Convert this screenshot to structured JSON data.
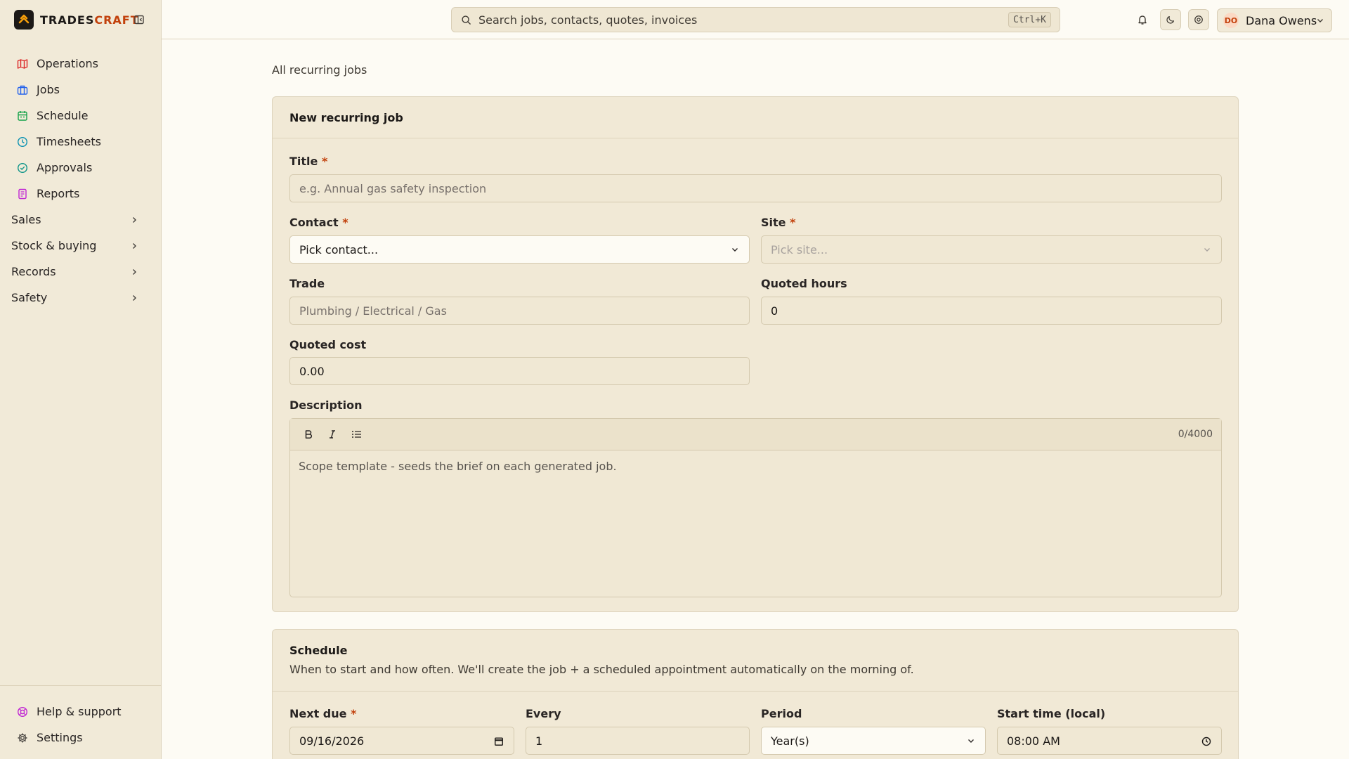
{
  "brand": {
    "name_main": "TRADES",
    "name_accent": "CRAFT"
  },
  "sidebar": {
    "items": [
      {
        "label": "Operations",
        "icon": "map-icon",
        "color": "#dc2626"
      },
      {
        "label": "Jobs",
        "icon": "briefcase-icon",
        "color": "#2563eb"
      },
      {
        "label": "Schedule",
        "icon": "calendar-icon",
        "color": "#16a34a"
      },
      {
        "label": "Timesheets",
        "icon": "clock-icon",
        "color": "#0891b2"
      },
      {
        "label": "Approvals",
        "icon": "check-circle-icon",
        "color": "#0d9488"
      },
      {
        "label": "Reports",
        "icon": "document-icon",
        "color": "#c026d3"
      }
    ],
    "groups": [
      {
        "label": "Sales"
      },
      {
        "label": "Stock & buying"
      },
      {
        "label": "Records"
      },
      {
        "label": "Safety"
      }
    ],
    "bottom": [
      {
        "label": "Help & support",
        "icon": "help-icon",
        "color": "#c026d3"
      },
      {
        "label": "Settings",
        "icon": "gear-icon",
        "color": "#44403c"
      }
    ]
  },
  "topbar": {
    "search_placeholder": "Search jobs, contacts, quotes, invoices",
    "shortcut": "Ctrl+K",
    "user": {
      "initials": "DO",
      "name": "Dana Owens"
    }
  },
  "breadcrumb": {
    "back_label": "All recurring jobs"
  },
  "job_card": {
    "title": "New recurring job",
    "fields": {
      "title": {
        "label": "Title",
        "required": "*",
        "placeholder": "e.g. Annual gas safety inspection"
      },
      "contact": {
        "label": "Contact",
        "required": "*",
        "value": "Pick contact..."
      },
      "site": {
        "label": "Site",
        "required": "*",
        "value": "Pick site..."
      },
      "trade": {
        "label": "Trade",
        "placeholder": "Plumbing / Electrical / Gas"
      },
      "quoted_hours": {
        "label": "Quoted hours",
        "value": "0"
      },
      "quoted_cost": {
        "label": "Quoted cost",
        "value": "0.00"
      },
      "description": {
        "label": "Description",
        "char_count": "0/4000",
        "placeholder": "Scope template - seeds the brief on each generated job."
      }
    }
  },
  "schedule_card": {
    "title": "Schedule",
    "subtitle": "When to start and how often. We'll create the job + a scheduled appointment automatically on the morning of.",
    "fields": {
      "next_due": {
        "label": "Next due",
        "required": "*",
        "value": "09/16/2026"
      },
      "every": {
        "label": "Every",
        "value": "1"
      },
      "period": {
        "label": "Period",
        "value": "Year(s)"
      },
      "start_time": {
        "label": "Start time (local)",
        "value": "08:00 AM"
      }
    }
  },
  "colors": {
    "accent": "#c2410c",
    "background": "#fdfbf4",
    "panel": "#f1e9d6"
  }
}
